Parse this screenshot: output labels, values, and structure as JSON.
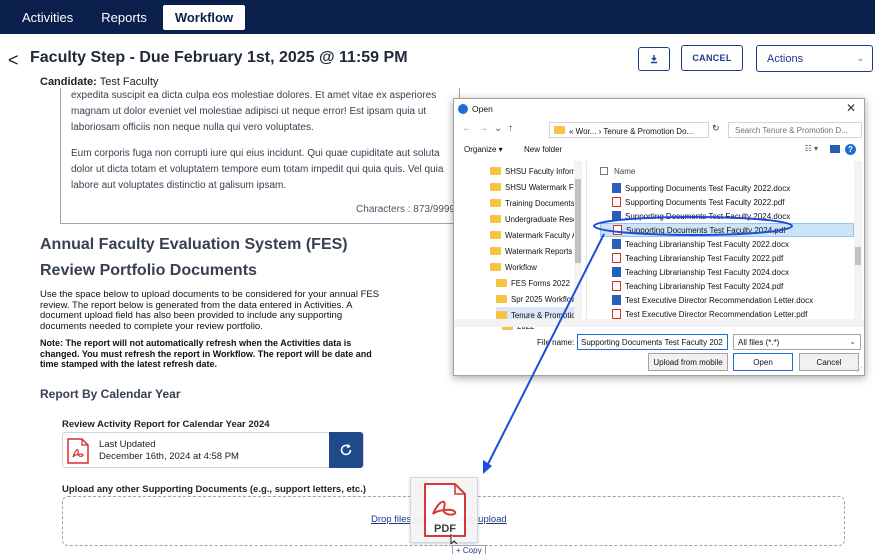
{
  "nav": {
    "tabs": [
      "Activities",
      "Reports",
      "Workflow"
    ],
    "active": "Workflow"
  },
  "header": {
    "back_glyph": "<",
    "title": "Faculty Step - Due February 1st, 2025 @ 11:59 PM",
    "candidate_label": "Candidate:",
    "candidate_value": "Test Faculty",
    "download_icon": "download-icon",
    "cancel_label": "CANCEL",
    "actions_label": "Actions"
  },
  "text_card": {
    "para1": "expedita suscipit ea dicta culpa eos molestiae dolores. Et amet vitae ex asperiores magnam ut dolor eveniet vel molestiae adipisci ut neque error! Est ipsam quia ut laboriosam officiis non neque nulla qui vero voluptates.",
    "para2": "Eum corporis fuga non corrupti iure qui eius incidunt. Qui quae cupiditate aut soluta dolor ut dicta totam et voluptatem tempore eum totam impedit qui quia quis. Vel quia labore aut voluptates distinctio at galisum ipsam.",
    "chars": "Characters : 873/9999"
  },
  "main": {
    "heading": "Annual Faculty Evaluation System (FES)",
    "subheading": "Review Portfolio Documents",
    "intro": "Use the space below to upload documents to be considered for your annual FES review. The report below is generated from the data entered in Activities. A document upload field has also been provided to include any supporting documents needed to complete your review portfolio.",
    "note": "Note: The report will not automatically refresh when the Activities data is changed. You must refresh the report in Workflow. The report will be date and time stamped with the latest refresh date.",
    "calendar_heading": "Report By Calendar Year",
    "rar_label": "Review Activity Report for Calendar Year 2024",
    "last_updated_label": "Last Updated",
    "last_updated_value": "December 16th, 2024 at 4:58 PM",
    "upload_label": "Upload any other Supporting Documents (e.g., support letters, etc.)",
    "drop_text": "Drop files here or click to upload",
    "drag_label": "PDF",
    "copy_badge": "+ Copy"
  },
  "dialog": {
    "title": "Open",
    "breadcrumb": "« Wor... › Tenure & Promotion Do...",
    "search_placeholder": "Search Tenure & Promotion D...",
    "organize": "Organize ▾",
    "new_folder": "New folder",
    "tree": [
      "SHSU Faculty Informa",
      "SHSU Watermark Fac",
      "Training Documents",
      "Undergraduate Resea",
      "Watermark Faculty A",
      "Watermark Reports",
      "Workflow",
      "FES Forms 2022",
      "Spr 2025 Workflow",
      "Tenure & Promotion",
      "2022"
    ],
    "column_name": "Name",
    "files": [
      {
        "name": "Supporting Documents Test Faculty 2022.docx",
        "type": "docx"
      },
      {
        "name": "Supporting Documents Test Faculty 2022.pdf",
        "type": "pdf"
      },
      {
        "name": "Supporting Documents Test Faculty 2024.docx",
        "type": "docx"
      },
      {
        "name": "Supporting Documents Test Faculty 2024.pdf",
        "type": "pdf"
      },
      {
        "name": "Teaching Librarianship Test Faculty 2022.docx",
        "type": "docx"
      },
      {
        "name": "Teaching Librarianship Test Faculty 2022.pdf",
        "type": "pdf"
      },
      {
        "name": "Teaching Librarianship Test Faculty 2024.docx",
        "type": "docx"
      },
      {
        "name": "Teaching Librarianship Test Faculty 2024.pdf",
        "type": "pdf"
      },
      {
        "name": "Test Executive Director Recommendation Letter.docx",
        "type": "docx"
      },
      {
        "name": "Test Executive Director Recommendation Letter.pdf",
        "type": "pdf"
      }
    ],
    "selected_file": "Supporting Documents Test Faculty 2024.pdf",
    "file_name_label": "File name:",
    "file_name_value": "Supporting Documents Test Faculty 202",
    "file_type": "All files (*.*)",
    "upload_mobile": "Upload from mobile",
    "open": "Open",
    "cancel": "Cancel"
  },
  "colors": {
    "nav_bg": "#0b1f4d",
    "accent": "#1e3a8a",
    "refresh_btn": "#1e4a8a",
    "annotation": "#1d4ed8",
    "pdf_red": "#d32f2f"
  }
}
